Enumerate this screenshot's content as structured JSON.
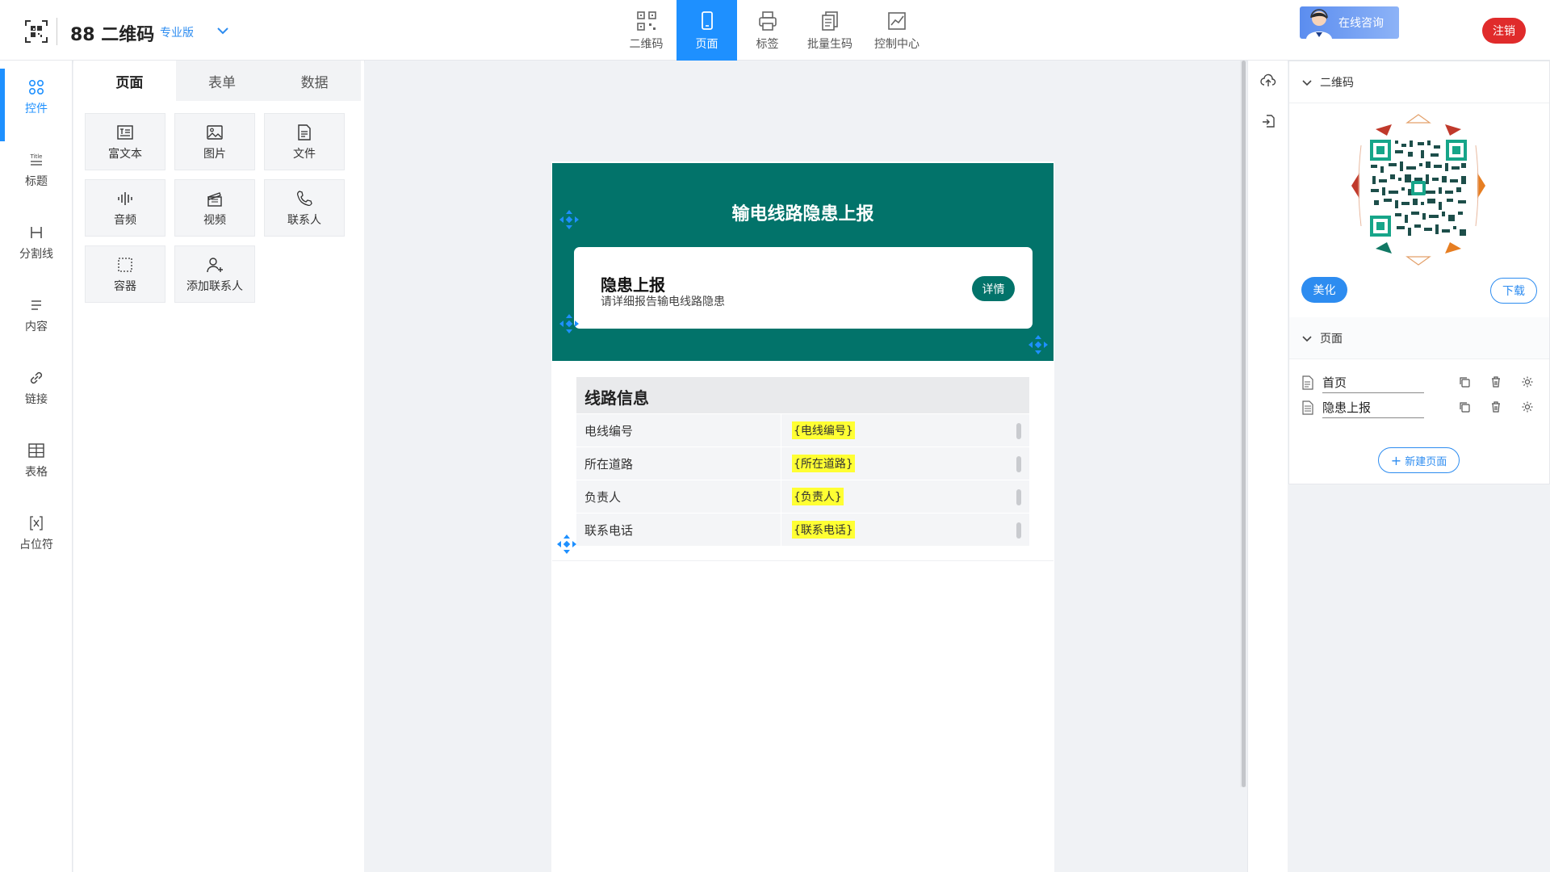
{
  "header": {
    "app_title": "88 二维码",
    "edition": "专业版",
    "nav_tabs": [
      {
        "label": "二维码",
        "icon": "qrcode-icon"
      },
      {
        "label": "页面",
        "icon": "mobile-page-icon"
      },
      {
        "label": "标签",
        "icon": "printer-icon"
      },
      {
        "label": "批量生码",
        "icon": "batch-doc-icon"
      },
      {
        "label": "控制中心",
        "icon": "chart-icon"
      }
    ],
    "active_tab": "页面",
    "consult_label": "在线咨询",
    "logout_label": "注销"
  },
  "left_rail": {
    "items": [
      {
        "label": "控件",
        "icon": "widgets-grid-icon"
      },
      {
        "label": "标题",
        "icon": "title-icon"
      },
      {
        "label": "分割线",
        "icon": "divider-icon"
      },
      {
        "label": "内容",
        "icon": "content-lines-icon"
      },
      {
        "label": "链接",
        "icon": "link-icon"
      },
      {
        "label": "表格",
        "icon": "table-icon"
      },
      {
        "label": "占位符",
        "icon": "placeholder-icon"
      }
    ],
    "active": "控件"
  },
  "widget_panel": {
    "tabs": [
      {
        "label": "页面"
      },
      {
        "label": "表单"
      },
      {
        "label": "数据"
      }
    ],
    "active_tab": "页面",
    "widgets": [
      {
        "label": "富文本",
        "icon": "rich-text-icon"
      },
      {
        "label": "图片",
        "icon": "image-icon"
      },
      {
        "label": "文件",
        "icon": "file-icon"
      },
      {
        "label": "音频",
        "icon": "audio-icon"
      },
      {
        "label": "视频",
        "icon": "video-icon"
      },
      {
        "label": "联系人",
        "icon": "phone-icon"
      },
      {
        "label": "容器",
        "icon": "container-icon"
      },
      {
        "label": "添加联系人",
        "icon": "add-contact-icon"
      }
    ]
  },
  "canvas": {
    "banner_title": "输电线路隐患上报",
    "banner_color": "#02736a",
    "report_card": {
      "title": "隐患上报",
      "subtitle": "请详细报告输电线路隐患",
      "detail_button": "详情"
    },
    "info_section": {
      "header": "线路信息",
      "rows": [
        {
          "label": "电线编号",
          "value": "{电线编号}"
        },
        {
          "label": "所在道路",
          "value": "{所在道路}"
        },
        {
          "label": "负责人",
          "value": "{负责人}"
        },
        {
          "label": "联系电话",
          "value": "{联系电话}"
        }
      ]
    }
  },
  "right_panel": {
    "qr_section_title": "二维码",
    "beautify_label": "美化",
    "download_label": "下载",
    "pages_section_title": "页面",
    "pages": [
      {
        "name": "首页"
      },
      {
        "name": "隐患上报"
      }
    ],
    "new_page_label": "新建页面"
  },
  "colors": {
    "accent": "#1e90ff",
    "primary_button": "#2d8cf0",
    "logout": "#e02b2b",
    "highlight": "#ffff33"
  }
}
